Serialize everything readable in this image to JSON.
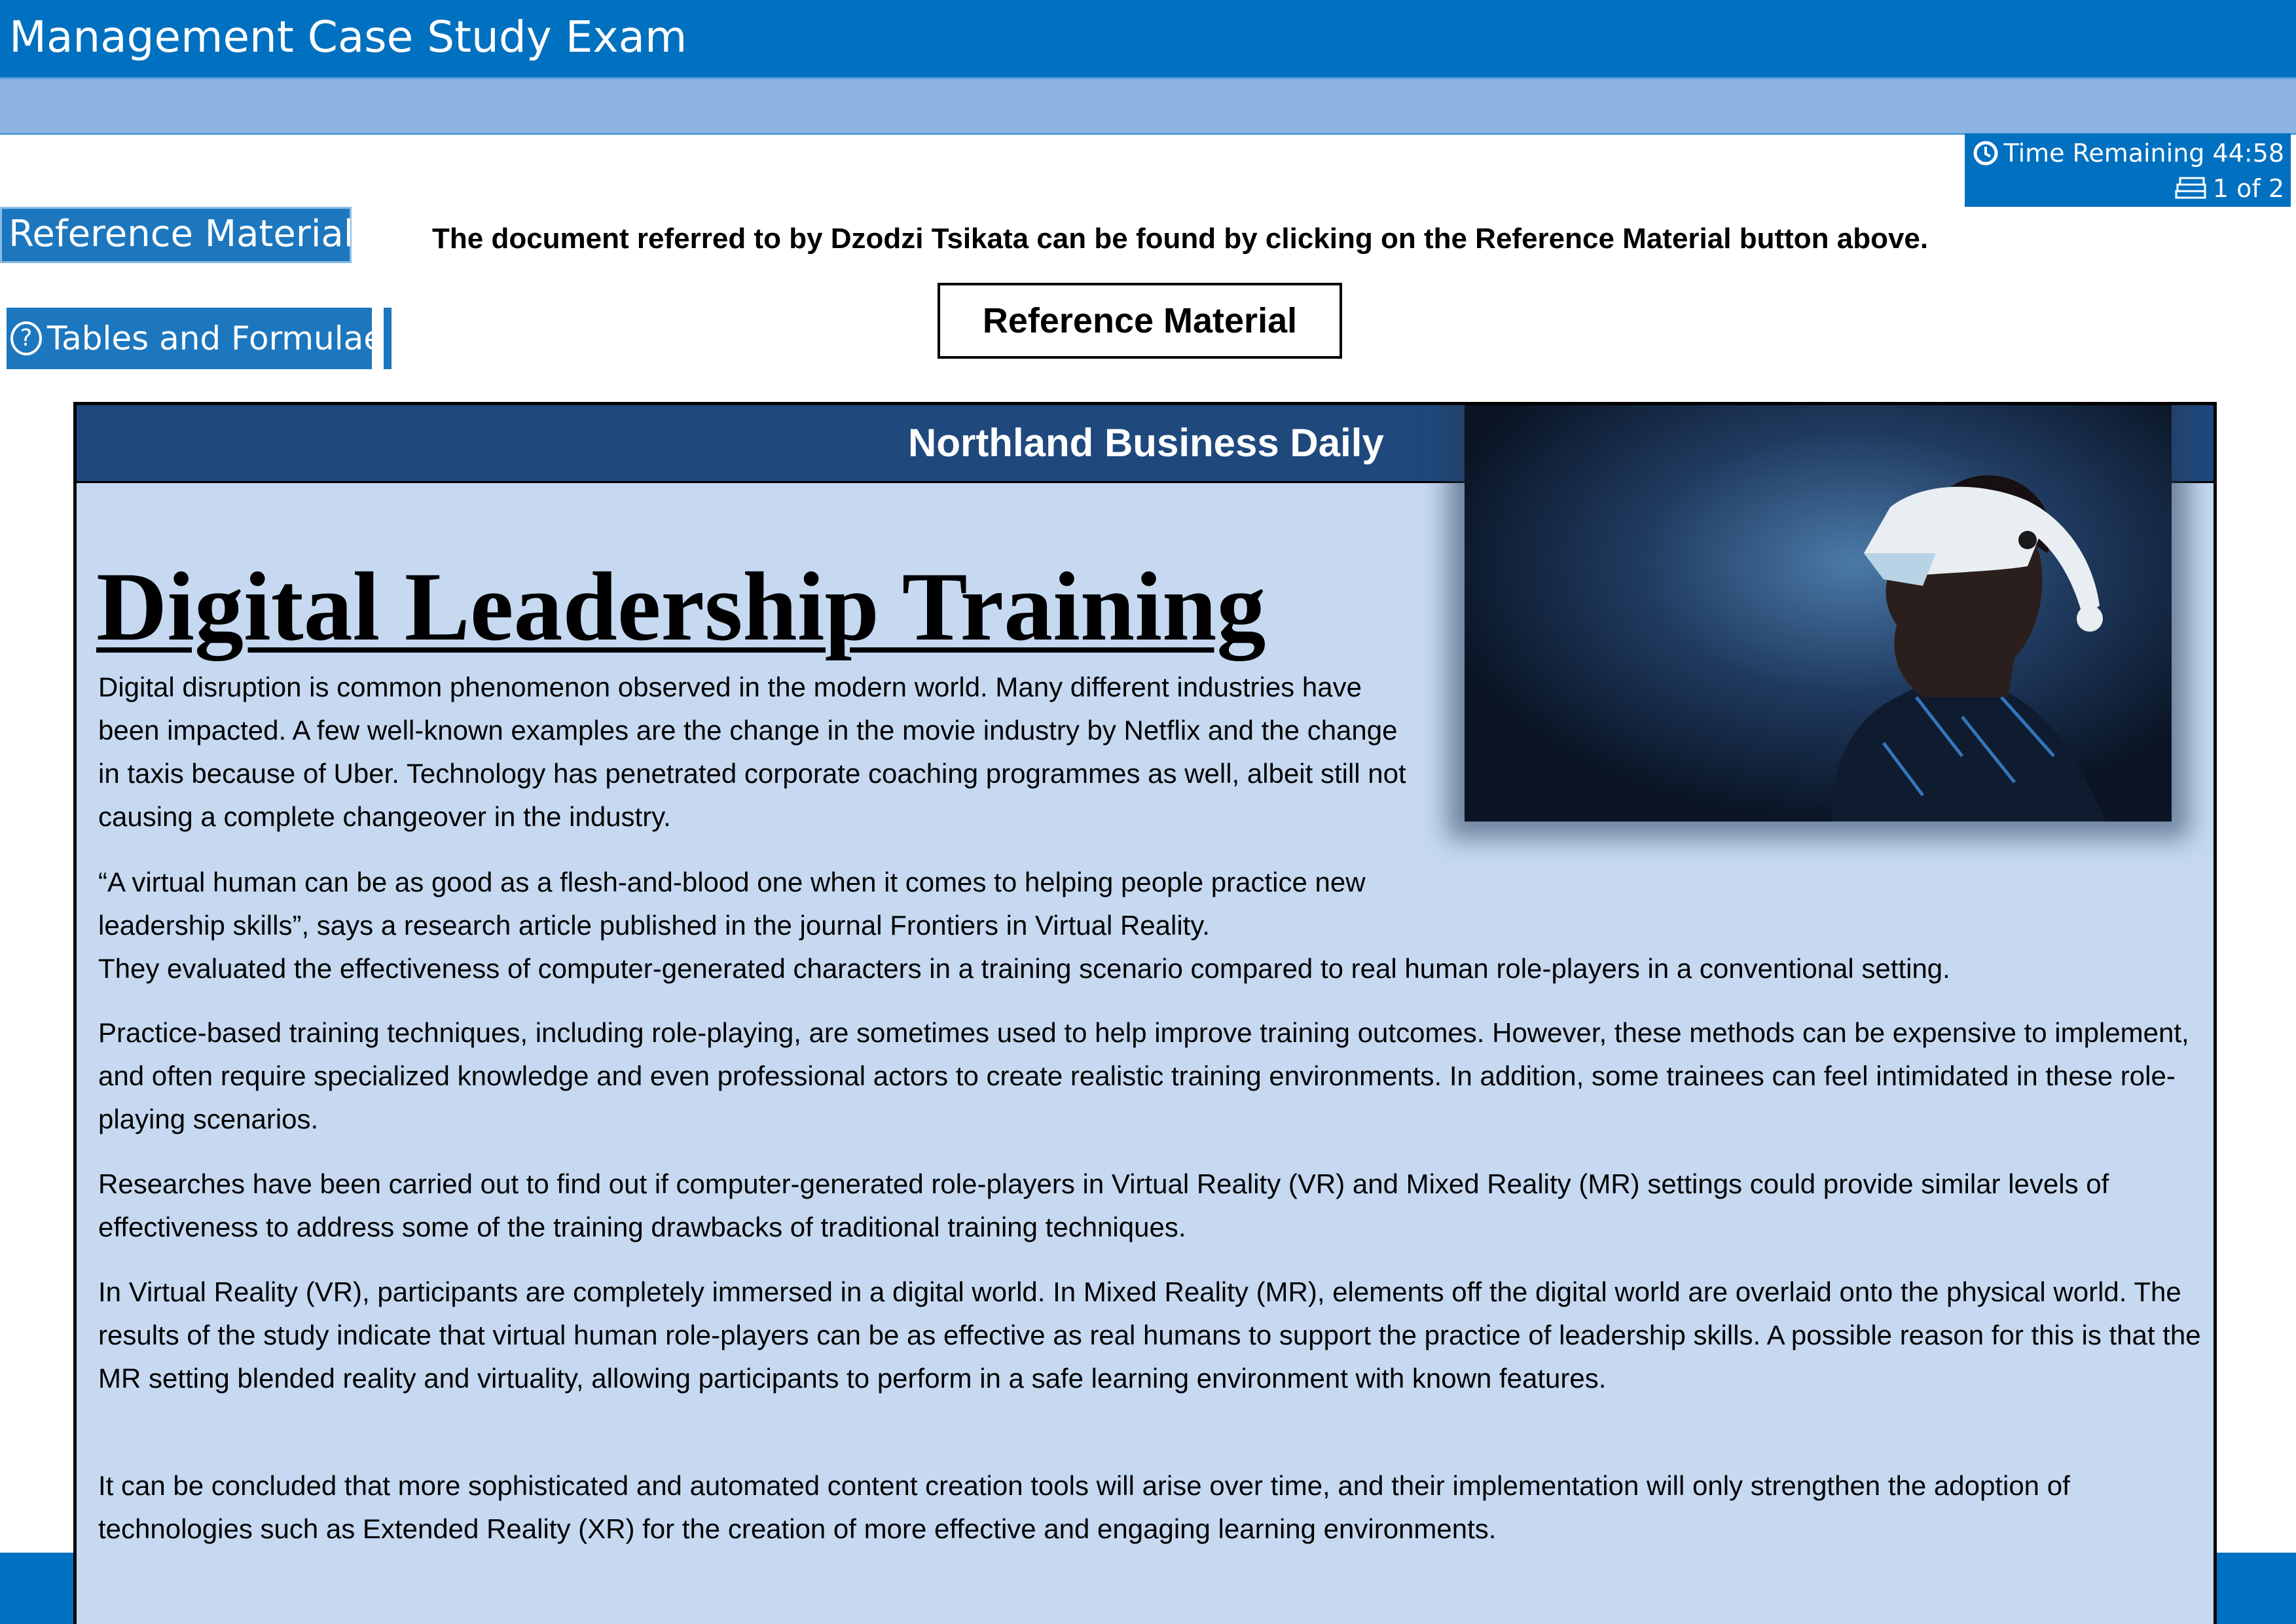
{
  "app": {
    "title": "Management Case Study Exam"
  },
  "timer": {
    "label": "Time Remaining 44:58",
    "page": "1 of 2"
  },
  "buttons": {
    "reference_material": "Reference Material",
    "tables_formulae": "Tables and Formulae",
    "reference_box": "Reference Material"
  },
  "instruction": "The document referred to by Dzodzi Tsikata can be found by clicking on the Reference Material button above.",
  "article": {
    "masthead": "Northland Business Daily",
    "headline": "Digital Leadership Training",
    "p1": "Digital disruption is common phenomenon observed in the modern world. Many different industries have been impacted. A few well-known examples are the change in the movie industry by Netflix and the change in taxis because of Uber. Technology has penetrated corporate coaching programmes as well, albeit still not causing a complete changeover in the industry.",
    "p2a": "“A virtual human can be as good as a flesh-and-blood one when it comes to helping people practice new leadership skills”, says a research article published in the journal Frontiers in Virtual Reality.",
    "p2b": "They evaluated the effectiveness of computer-generated characters in a training scenario compared to real human role-players in a conventional setting.",
    "p3": "Practice-based training techniques, including role-playing, are sometimes used to help improve training outcomes. However, these methods can be expensive to implement, and often require specialized knowledge and even professional actors to create realistic training environments. In addition, some trainees can feel intimidated in these role-playing scenarios.",
    "p4": "Researches have been carried out to find out if computer-generated role-players in Virtual Reality (VR) and Mixed Reality (MR) settings could provide similar levels of effectiveness to address some of the training drawbacks of traditional training techniques.",
    "p5": "In Virtual Reality (VR), participants are completely immersed in a digital world. In Mixed Reality (MR), elements off the digital world are overlaid onto the physical world. The results of the study indicate that virtual human role-players can be as effective as real humans to support the practice of leadership skills. A possible reason for this is that the MR setting blended reality and virtuality, allowing participants to perform in a safe learning environment with known features.",
    "p6": "It can be concluded that more sophisticated and automated content creation tools will arise over time, and their implementation will only strengthen the adoption of technologies such as Extended Reality (XR) for the creation of more effective and engaging learning environments."
  },
  "icons": {
    "clock": "clock-icon",
    "pages": "pages-icon",
    "help": "question-circle-icon"
  },
  "colors": {
    "primary_blue": "#0070c0",
    "light_blue_bar": "#8db4e2",
    "masthead": "#1f497d",
    "article_bg": "#c6d9f1"
  }
}
